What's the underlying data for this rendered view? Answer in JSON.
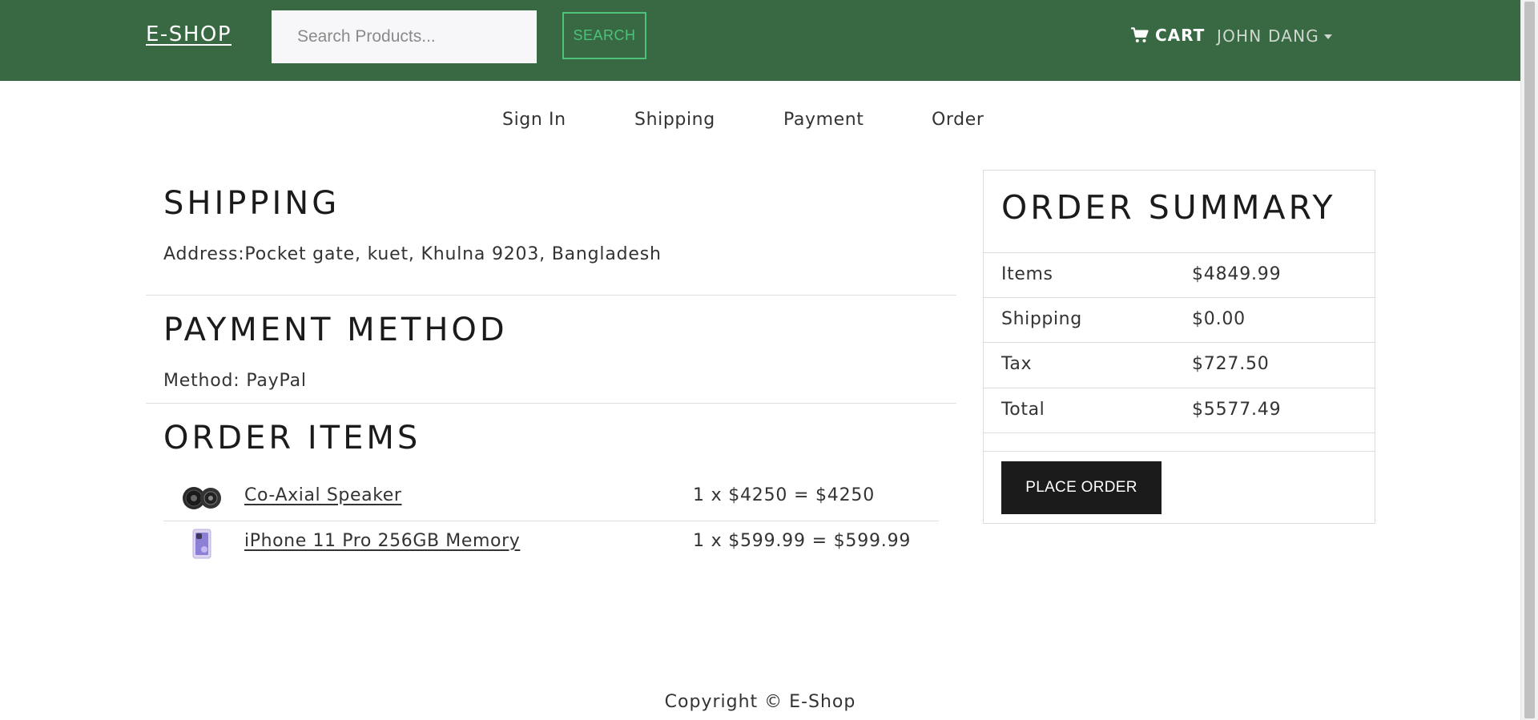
{
  "navbar": {
    "brand": "E-SHOP",
    "search_placeholder": "Search Products...",
    "search_button": "SEARCH",
    "cart_label": "CART",
    "user_name": "JOHN DANG"
  },
  "steps": [
    "Sign In",
    "Shipping",
    "Payment",
    "Order"
  ],
  "shipping": {
    "title": "SHIPPING",
    "address": "Address:Pocket gate, kuet, Khulna 9203, Bangladesh"
  },
  "payment": {
    "title": "PAYMENT METHOD",
    "method": "Method: PayPal"
  },
  "order_items": {
    "title": "ORDER ITEMS",
    "items": [
      {
        "name": "Co-Axial Speaker",
        "price_text": "1 x $4250 = $4250"
      },
      {
        "name": "iPhone 11 Pro 256GB Memory",
        "price_text": "1 x $599.99 = $599.99"
      }
    ]
  },
  "summary": {
    "title": "ORDER SUMMARY",
    "rows": [
      {
        "label": "Items",
        "value": "$4849.99"
      },
      {
        "label": "Shipping",
        "value": "$0.00"
      },
      {
        "label": "Tax",
        "value": "$727.50"
      },
      {
        "label": "Total",
        "value": "$5577.49"
      }
    ],
    "place_order": "PLACE ORDER"
  },
  "footer": {
    "copyright": "Copyright © E-Shop"
  },
  "colors": {
    "navbar_bg": "#386942",
    "search_accent": "#4cc27a",
    "button_dark": "#1b1b1b"
  }
}
